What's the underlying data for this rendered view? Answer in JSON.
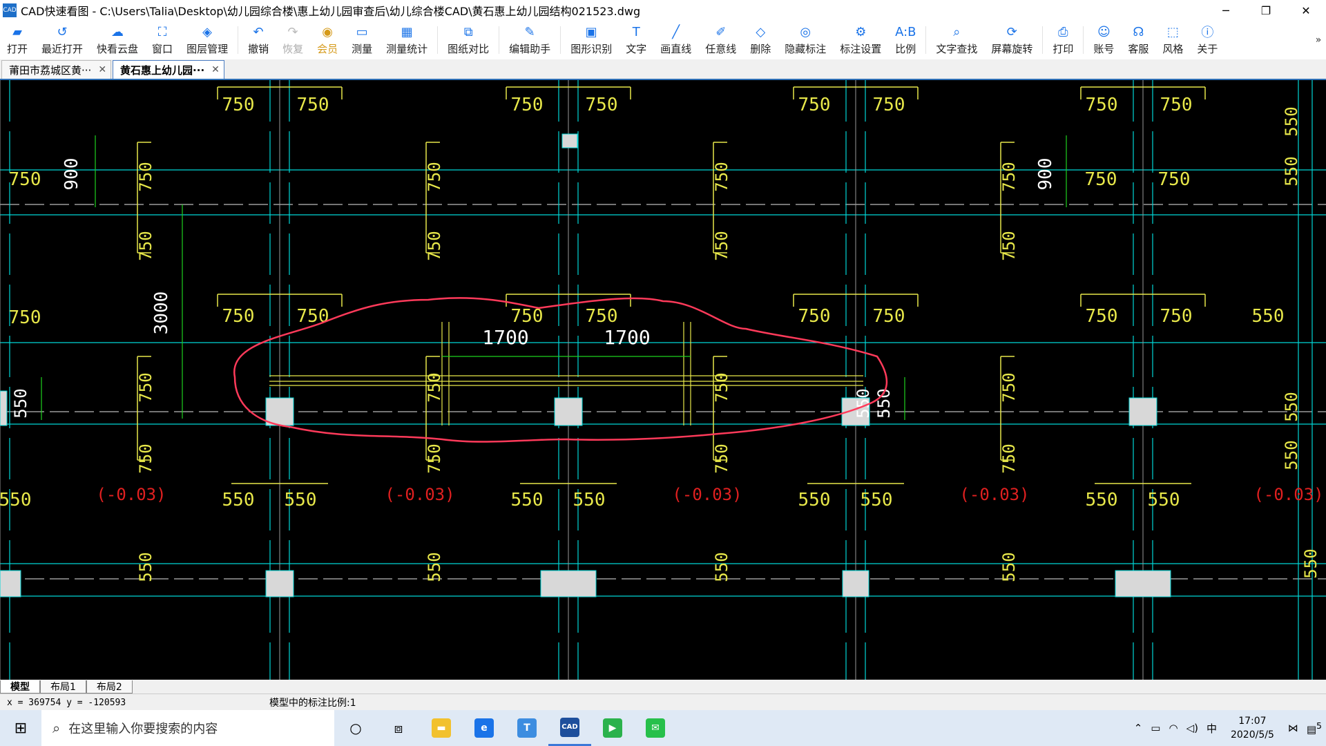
{
  "window": {
    "title": "CAD快速看图 - C:\\Users\\Talia\\Desktop\\幼儿园综合楼\\惠上幼儿园审查后\\幼儿综合楼CAD\\黄石惠上幼儿园结构021523.dwg",
    "app_icon": "CAD",
    "minimize": "─",
    "restore": "❐",
    "close": "✕"
  },
  "toolbar": {
    "open": "打开",
    "recent": "最近打开",
    "cloud": "快看云盘",
    "window": "窗口",
    "layers": "图层管理",
    "undo": "撤销",
    "redo": "恢复",
    "vip": "会员",
    "measure": "测量",
    "measure_stats": "测量统计",
    "compare": "图纸对比",
    "edit_helper": "编辑助手",
    "shape_recog": "图形识别",
    "text": "文字",
    "line": "画直线",
    "freeline": "任意线",
    "delete": "删除",
    "hide_dim": "隐藏标注",
    "dim_settings": "标注设置",
    "scale": "比例",
    "text_find": "文字查找",
    "rotate": "屏幕旋转",
    "print": "打印",
    "account": "账号",
    "service": "客服",
    "style": "风格",
    "about": "关于",
    "more": "»"
  },
  "doc_tabs": [
    {
      "label": "莆田市荔城区黄···",
      "close": "✕"
    },
    {
      "label": "黄石惠上幼儿园···",
      "close": "✕"
    }
  ],
  "drawing": {
    "dims": {
      "d750": "750",
      "d900": "900",
      "d550": "550",
      "d3000": "3000",
      "d1700": "1700"
    },
    "elevation": "(-0.03)"
  },
  "layout_tabs": [
    "模型",
    "布局1",
    "布局2"
  ],
  "status": {
    "coords": "x = 369754  y = -120593",
    "scale_text": "模型中的标注比例:1"
  },
  "taskbar": {
    "search_placeholder": "在这里输入你要搜索的内容",
    "ime": "中",
    "time": "17:07",
    "date": "2020/5/5",
    "notif_count": "5"
  },
  "colors": {
    "cyan": "#00d7d7",
    "yellow": "#e8e84a",
    "red": "#e02020",
    "green": "#1ed21e",
    "markup": "#ff3a5a"
  }
}
